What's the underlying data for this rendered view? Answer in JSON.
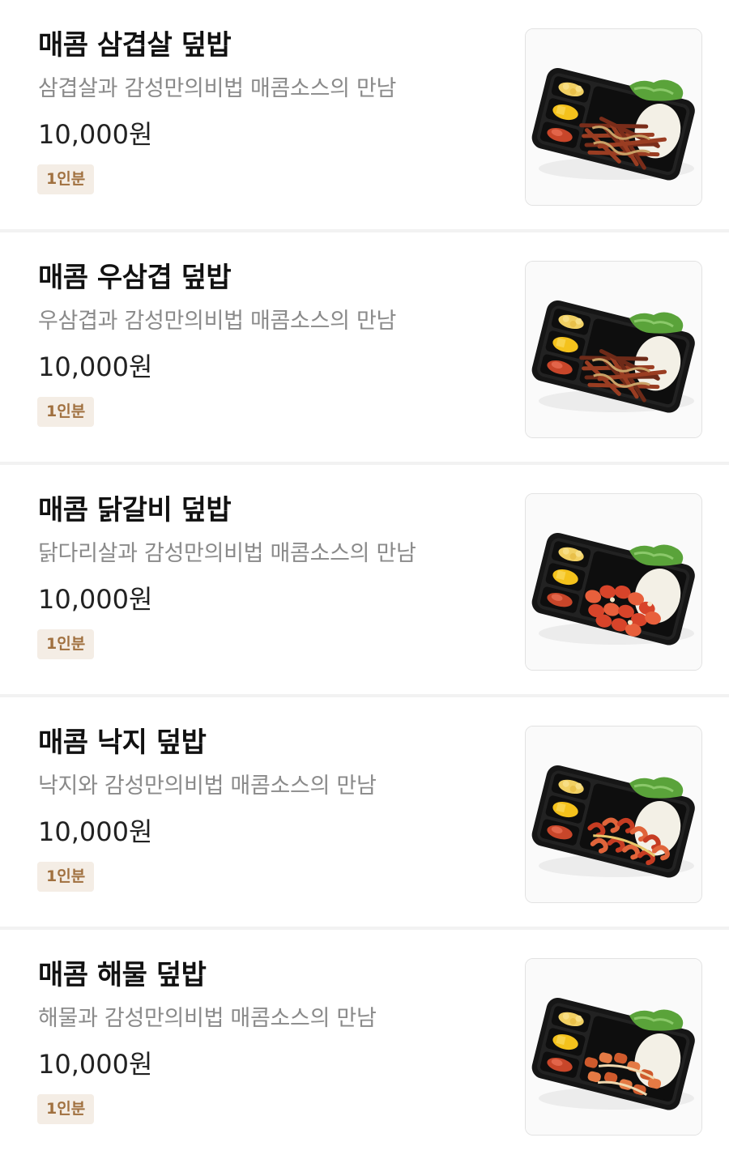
{
  "menu": {
    "items": [
      {
        "name": "매콤 삼겹살 덮밥",
        "description": "삼겹살과 감성만의비법 매콤소스의 만남",
        "price": "10,000원",
        "serving": "1인분",
        "topping_color": "#7a2d1a",
        "topping_style": "strips"
      },
      {
        "name": "매콤 우삼겹 덮밥",
        "description": "우삼겹과 감성만의비법 매콤소스의 만남",
        "price": "10,000원",
        "serving": "1인분",
        "topping_color": "#6e2a18",
        "topping_style": "strips"
      },
      {
        "name": "매콤 닭갈비 덮밥",
        "description": "닭다리살과 감성만의비법 매콤소스의 만남",
        "price": "10,000원",
        "serving": "1인분",
        "topping_color": "#d8442a",
        "topping_style": "chunks"
      },
      {
        "name": "매콤 낙지 덮밥",
        "description": "낙지와 감성만의비법 매콤소스의 만남",
        "price": "10,000원",
        "serving": "1인분",
        "topping_color": "#c63c22",
        "topping_style": "tentacles"
      },
      {
        "name": "매콤 해물 덮밥",
        "description": "해물과 감성만의비법 매콤소스의 만남",
        "price": "10,000원",
        "serving": "1인분",
        "topping_color": "#cf5a2c",
        "topping_style": "mixed"
      }
    ]
  }
}
